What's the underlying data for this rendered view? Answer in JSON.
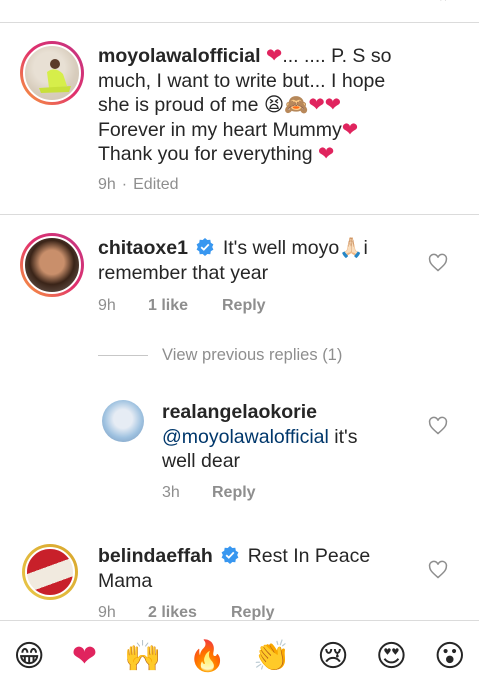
{
  "colors": {
    "heart": "#e0245e",
    "link": "#00376b",
    "meta": "#8e8e8e",
    "verified": "#3897f0"
  },
  "comments": [
    {
      "username": "moyolawalofficial",
      "text_lines": [
        "❤... .... P. S so",
        "much, I want to write but... I hope",
        "she is proud of me 😫🙈❤❤",
        "Forever in my heart Mummy❤",
        "Thank you for everything ❤"
      ],
      "time": "9h",
      "edited": "Edited"
    },
    {
      "username": "chitaoxe1",
      "text_line1": "It's well moyo🙏🏻i",
      "text_line2": "remember that year",
      "time": "9h",
      "likes": "1 like",
      "reply": "Reply"
    }
  ],
  "view_previous": "View previous replies (1)",
  "reply_comment": {
    "username": "realangelaokorie",
    "mention": "@moyolawalofficial",
    "text_tail": " it's",
    "text_line3": "well dear",
    "time": "3h",
    "reply": "Reply"
  },
  "third_comment": {
    "username": "belindaeffah",
    "text_line1": "Rest In Peace",
    "text_line2": "Mama",
    "time": "9h",
    "likes": "2 likes",
    "reply": "Reply"
  },
  "emoji_bar": [
    {
      "name": "grinning-emoji",
      "char": "😁"
    },
    {
      "name": "heart-emoji",
      "char": "❤"
    },
    {
      "name": "raised-hands-emoji",
      "char": "🙌"
    },
    {
      "name": "fire-emoji",
      "char": "🔥"
    },
    {
      "name": "clapping-emoji",
      "char": "👏"
    },
    {
      "name": "crying-emoji",
      "char": "😢"
    },
    {
      "name": "heart-eyes-emoji",
      "char": "😍"
    },
    {
      "name": "surprised-emoji",
      "char": "😮"
    }
  ]
}
